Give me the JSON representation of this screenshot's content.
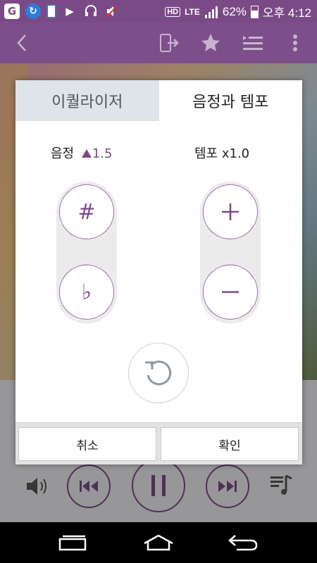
{
  "status_bar": {
    "signal_percent": "62%",
    "network": "LTE",
    "hd_label": "HD",
    "time": "오후 4:12"
  },
  "dialog": {
    "tabs": [
      {
        "label": "이퀄라이저",
        "active": false
      },
      {
        "label": "음정과 템포",
        "active": true
      }
    ],
    "pitch": {
      "label": "음정",
      "value": "1.5"
    },
    "tempo": {
      "label": "템포 x1.0"
    },
    "pitch_up_symbol": "#",
    "pitch_down_symbol": "♭",
    "cancel_label": "취소",
    "confirm_label": "확인"
  },
  "colors": {
    "accent": "#7a4a86",
    "status_bar": "#7a4a86",
    "tab_inactive_bg": "#dde4ea"
  }
}
